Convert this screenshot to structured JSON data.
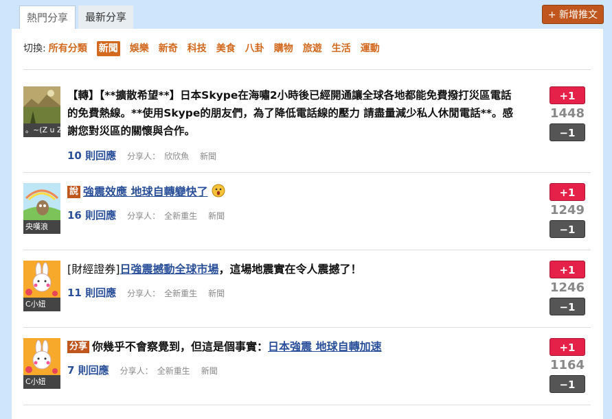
{
  "tabs": [
    {
      "label": "熱門分享",
      "active": true
    },
    {
      "label": "最新分享",
      "active": false
    }
  ],
  "new_post_label": "+ 新增推文",
  "filter": {
    "label": "切換:",
    "categories": [
      "所有分類",
      "新聞",
      "娛樂",
      "新奇",
      "科技",
      "美食",
      "八卦",
      "購物",
      "旅遊",
      "生活",
      "運動"
    ],
    "selected": "新聞"
  },
  "posts": [
    {
      "author": "。~(Z u Z",
      "tag": "",
      "title_pre": "【轉】【**擴散希望**】日本Skype在海嘯2小時後已經開通讓全球各地都能免費撥打災區電話的免費熱線。**使用Skype的朋友們，為了降低電話線的壓力 請盡量減少私人休閒電話**。感謝您對災區的關懷與合作。",
      "title_link": "",
      "title_post": "",
      "replies": "10 則回應",
      "sharer_label": "分享人：",
      "sharer": "欣欣魚",
      "category": "新聞",
      "votes": "1448",
      "plus": "+1",
      "minus": "−1"
    },
    {
      "author": "央嘆浪",
      "tag": "說",
      "title_pre": "",
      "title_link": "強震效應 地球自轉變快了",
      "title_post": "",
      "replies": "16 則回應",
      "sharer_label": "分享人：",
      "sharer": "全新重生",
      "category": "新聞",
      "votes": "1249",
      "plus": "+1",
      "minus": "−1"
    },
    {
      "author": "C小妞",
      "tag": "",
      "title_pre": "[財經證券]",
      "title_link": "日強震撼動全球市場",
      "title_post": "，這場地震實在令人震撼了！",
      "replies": "11 則回應",
      "sharer_label": "分享人：",
      "sharer": "全新重生",
      "category": "新聞",
      "votes": "1246",
      "plus": "+1",
      "minus": "−1"
    },
    {
      "author": "C小妞",
      "tag": "分享",
      "title_pre": "你幾乎不會察覺到，但這是個事實：",
      "title_link": "日本強震 地球自轉加速",
      "title_post": "",
      "replies": "7 則回應",
      "sharer_label": "分享人：",
      "sharer": "全新重生",
      "category": "新聞",
      "votes": "1164",
      "plus": "+1",
      "minus": "−1"
    }
  ],
  "colors": {
    "accent": "#d2691e",
    "plus": "#e5214a",
    "minus": "#555555",
    "link": "#2a4f9a",
    "bg": "#cfe5fb"
  }
}
